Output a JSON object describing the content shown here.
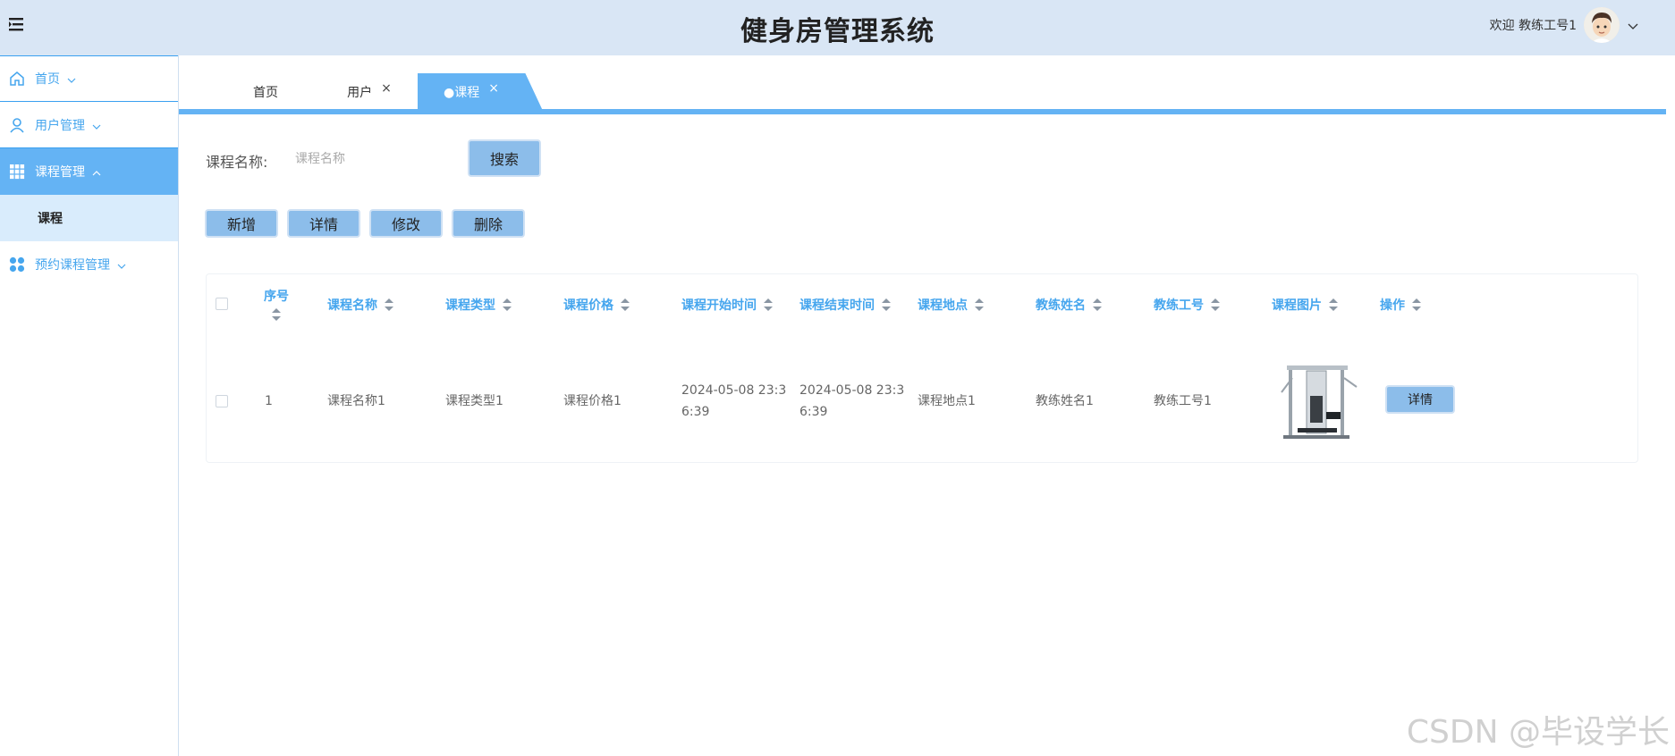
{
  "header": {
    "title": "健身房管理系统",
    "welcome": "欢迎 教练工号1"
  },
  "sidebar": {
    "items": [
      {
        "label": "首页",
        "icon": "home-icon"
      },
      {
        "label": "用户管理",
        "icon": "user-icon"
      },
      {
        "label": "课程管理",
        "icon": "grid-icon",
        "active": true,
        "children": [
          {
            "label": "课程"
          }
        ]
      },
      {
        "label": "预约课程管理",
        "icon": "apps-icon"
      }
    ]
  },
  "tabs": [
    {
      "label": "首页",
      "closable": false
    },
    {
      "label": "用户",
      "closable": true
    },
    {
      "label": "●课程",
      "closable": true,
      "active": true
    }
  ],
  "search": {
    "label": "课程名称:",
    "placeholder": "课程名称",
    "button": "搜索"
  },
  "actions": {
    "add": "新增",
    "detail": "详情",
    "edit": "修改",
    "delete": "删除"
  },
  "table": {
    "columns": [
      "序号",
      "课程名称",
      "课程类型",
      "课程价格",
      "课程开始时间",
      "课程结束时间",
      "课程地点",
      "教练姓名",
      "教练工号",
      "课程图片",
      "操作"
    ],
    "rows": [
      {
        "index": "1",
        "name": "课程名称1",
        "type": "课程类型1",
        "price": "课程价格1",
        "start_line1": "2024-05-08 23:3",
        "start_line2": "6:39",
        "end_line1": "2024-05-08 23:3",
        "end_line2": "6:39",
        "location": "课程地点1",
        "coach_name": "教练姓名1",
        "coach_id": "教练工号1",
        "image": "gym-machine-image",
        "action": "详情"
      }
    ]
  },
  "watermark": "CSDN @毕设学长",
  "colors": {
    "header_bg": "#d9e6f5",
    "accent": "#64b3f4",
    "button_bg": "#8cbdea",
    "sidebar_text": "#46a6ee"
  }
}
